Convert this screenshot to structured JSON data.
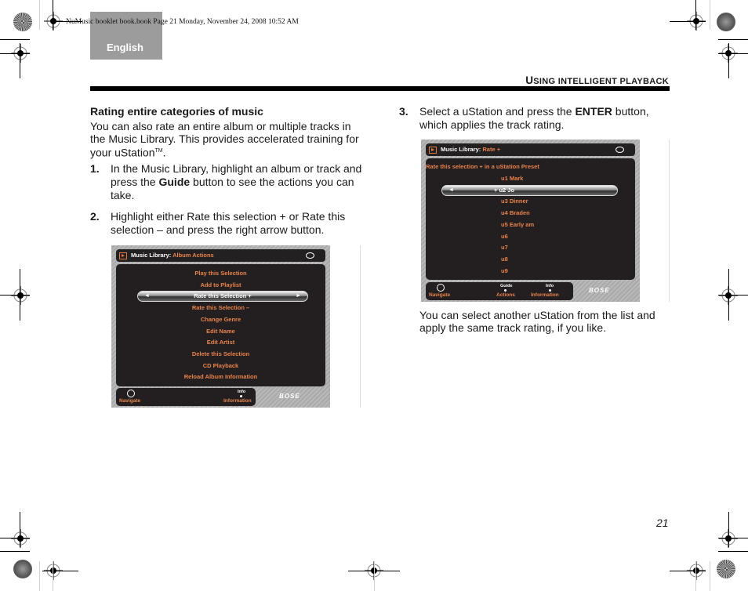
{
  "slug": "NuMusic booklet book.book  Page 21  Monday, November 24, 2008  10:52 AM",
  "language_tab": "English",
  "header": {
    "title_first": "U",
    "title_rest": "SING INTELLIGENT PLAYBACK"
  },
  "section": {
    "heading": "Rating entire categories of music",
    "intro": "You can also rate an entire album or multiple tracks in the Music Library. This provides accelerated training for your uStation",
    "intro_tm": "TM",
    "intro_end": "."
  },
  "steps": [
    {
      "number": "1.",
      "text_before": "In the Music Library, highlight an album or track and press the ",
      "bold": "Guide",
      "text_after": " button to see the actions you can take."
    },
    {
      "number": "2.",
      "text_before": "Highlight either Rate this selection + or Rate this selection – and press the right arrow button.",
      "bold": "",
      "text_after": ""
    },
    {
      "number": "3.",
      "text_before": "Select a uStation and press the ",
      "bold": "ENTER",
      "text_after": " button, which applies the track rating."
    }
  ],
  "closing": "You can select another uStation from the list and apply the same track rating, if you like.",
  "page_number": "21",
  "screen1": {
    "title_label": "Music Library: ",
    "title_value": "Album Actions",
    "menu": [
      "Play this Selection",
      "Add to Playlist",
      "Rate this Selection +",
      "Rate this Selection –",
      "Change Genre",
      "Edit Name",
      "Edit Artist",
      "Delete this Selection",
      "CD Playback",
      "Reload Album Information"
    ],
    "selected_index": 2,
    "arrow_left": "◄",
    "arrow_right": "►",
    "footer": {
      "navigate": "Navigate",
      "info_key": "Info",
      "info_label": "Information"
    },
    "brand": "BOSE"
  },
  "screen2": {
    "title_label": "Music Library: ",
    "title_value": "Rate +",
    "subtitle": "Rate this selection + in a uStation Preset",
    "presets": [
      "u1 Mark",
      "+ u2 Jo",
      "u3 Dinner",
      "u4 Braden",
      "u5 Early am",
      "u6",
      "u7",
      "u8",
      "u9"
    ],
    "selected_index": 1,
    "arrow_left": "◄",
    "footer": {
      "navigate": "Navigate",
      "guide_key": "Guide",
      "guide_label": "Actions",
      "info_key": "Info",
      "info_label": "Information"
    },
    "brand": "BOSE"
  },
  "colors": {
    "accent_orange": "#e8834a",
    "screen_dark": "#231f20",
    "language_tab": "#9c9c9c"
  }
}
